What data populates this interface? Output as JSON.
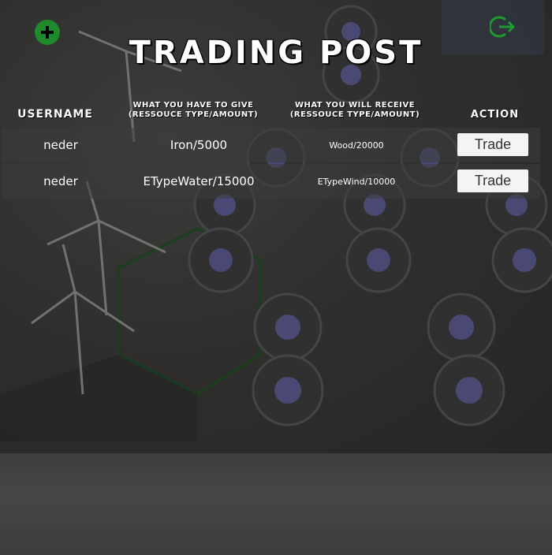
{
  "title": "Trading Post",
  "icons": {
    "add": "plus-circle-icon",
    "logout": "logout-icon",
    "accent": "#1f8a2b"
  },
  "table": {
    "headers": {
      "username": "Username",
      "give": [
        "What you have to give",
        "(Ressouce Type/Amount)"
      ],
      "receive": [
        "What you will receive",
        "(Ressouce Type/Amount)"
      ],
      "action": "Action"
    },
    "rows": [
      {
        "username": "neder",
        "give": "Iron/5000",
        "receive": "Wood/20000",
        "action": "Trade"
      },
      {
        "username": "neder",
        "give": "ETypeWater/15000",
        "receive": "ETypeWind/10000",
        "action": "Trade"
      }
    ]
  }
}
